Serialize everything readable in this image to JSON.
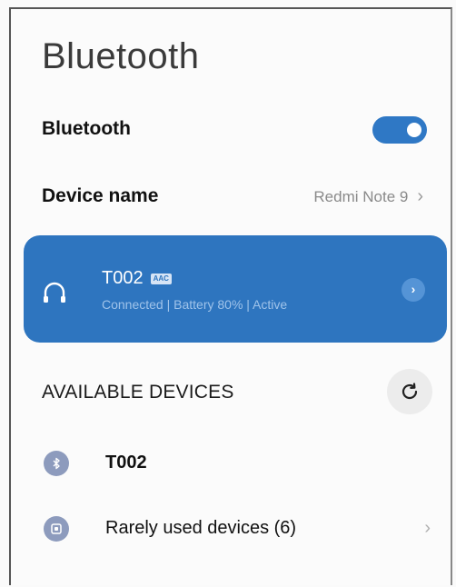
{
  "header": {
    "title": "Bluetooth"
  },
  "bluetooth_toggle": {
    "label": "Bluetooth",
    "enabled": true
  },
  "device_name": {
    "label": "Device name",
    "value": "Redmi Note 9",
    "chevron": "›"
  },
  "connected_device": {
    "name": "T002",
    "codec": "AAC",
    "status": "Connected | Battery 80% | Active",
    "icon": "headphones-icon",
    "arrow": "›"
  },
  "available_devices": {
    "header": "AVAILABLE DEVICES",
    "refresh_icon": "refresh-icon",
    "items": [
      {
        "label": "T002",
        "icon": "bluetooth-icon"
      },
      {
        "label": "Rarely used devices (6)",
        "icon": "devices-icon",
        "chevron": "›"
      }
    ]
  },
  "colors": {
    "accent": "#2e75bf",
    "toggle": "#2f78c5",
    "list_icon": "#8d9bbd"
  }
}
